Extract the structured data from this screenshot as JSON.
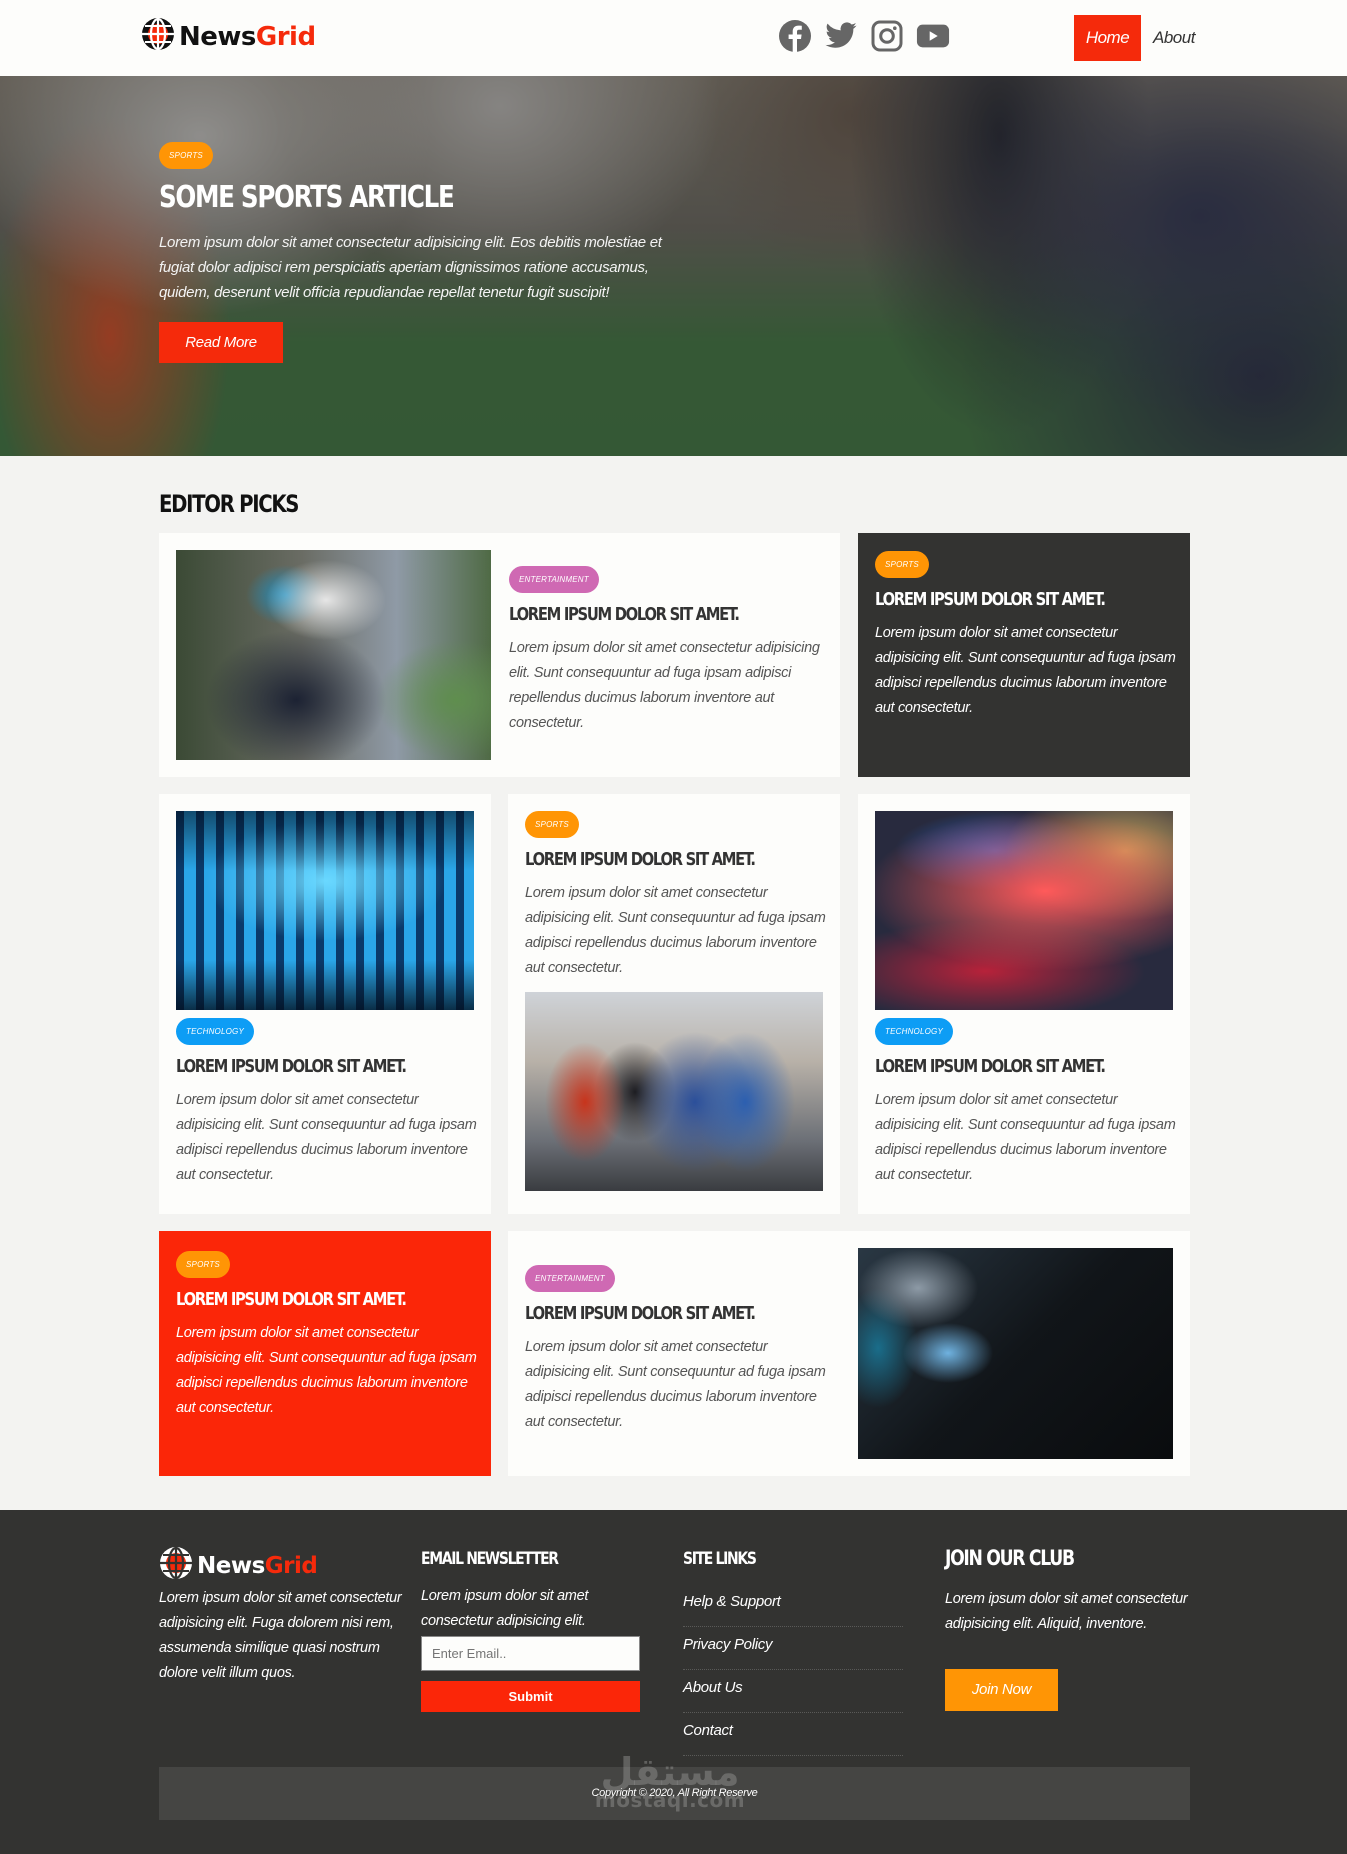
{
  "header": {
    "logo": {
      "part1": "News",
      "part2": "Grid",
      "icon": "globe-icon"
    },
    "social": [
      {
        "name": "facebook",
        "icon": "facebook-icon"
      },
      {
        "name": "twitter",
        "icon": "twitter-icon"
      },
      {
        "name": "instagram",
        "icon": "instagram-icon"
      },
      {
        "name": "youtube",
        "icon": "youtube-icon"
      }
    ],
    "nav": [
      {
        "label": "Home",
        "active": true
      },
      {
        "label": "About",
        "active": false
      }
    ]
  },
  "hero": {
    "badge": "Sports",
    "title": "Some Sports Article",
    "text": "Lorem ipsum dolor sit amet consectetur adipisicing elit. Eos debitis molestiae et fugiat dolor adipisci rem perspiciatis aperiam dignissimos ratione accusamus, quidem, deserunt velit officia repudiandae repellat tenetur fugit suscipit!",
    "button": "Read More"
  },
  "editor_picks": {
    "title": "Editor Picks",
    "cards": [
      {
        "badge": "Entertainment",
        "title": "Lorem ipsum dolor sit amet.",
        "text": "Lorem ipsum dolor sit amet consectetur adipisicing elit. Sunt consequuntur ad fuga ipsam adipisci repellendus ducimus laborum inventore aut consectetur.",
        "image": "vr-headset-man"
      },
      {
        "badge": "Sports",
        "title": "Lorem ipsum dolor sit amet.",
        "text": "Lorem ipsum dolor sit amet consectetur adipisicing elit. Sunt consequuntur ad fuga ipsam adipisci repellendus ducimus laborum inventore aut consectetur."
      },
      {
        "badge": "Technology",
        "title": "Lorem ipsum dolor sit amet.",
        "text": "Lorem ipsum dolor sit amet consectetur adipisicing elit. Sunt consequuntur ad fuga ipsam adipisci repellendus ducimus laborum inventore aut consectetur.",
        "image": "server-rack"
      },
      {
        "badge": "Sports",
        "title": "Lorem ipsum dolor sit amet.",
        "text": "Lorem ipsum dolor sit amet consectetur adipisicing elit. Sunt consequuntur ad fuga ipsam adipisci repellendus ducimus laborum inventore aut consectetur.",
        "image": "cyclists"
      },
      {
        "badge": "Technology",
        "title": "Lorem ipsum dolor sit amet.",
        "text": "Lorem ipsum dolor sit amet consectetur adipisicing elit. Sunt consequuntur ad fuga ipsam adipisci repellendus ducimus laborum inventore aut consectetur.",
        "image": "laptop-keyboard"
      },
      {
        "badge": "Sports",
        "title": "Lorem ipsum dolor sit amet.",
        "text": "Lorem ipsum dolor sit amet consectetur adipisicing elit. Sunt consequuntur ad fuga ipsam adipisci repellendus ducimus laborum inventore aut consectetur."
      },
      {
        "badge": "Entertainment",
        "title": "Lorem ipsum dolor sit amet.",
        "text": "Lorem ipsum dolor sit amet consectetur adipisicing elit. Sunt consequuntur ad fuga ipsam adipisci repellendus ducimus laborum inventore aut consectetur.",
        "image": "video-camera"
      }
    ]
  },
  "footer": {
    "logo": {
      "part1": "News",
      "part2": "Grid"
    },
    "about_text": "Lorem ipsum dolor sit amet consectetur adipisicing elit. Fuga dolorem nisi rem, assumenda similique quasi nostrum dolore velit illum quos.",
    "newsletter": {
      "title": "Email Newsletter",
      "text": "Lorem ipsum dolor sit amet consectetur adipisicing elit.",
      "placeholder": "Enter Email..",
      "button": "Submit"
    },
    "site_links": {
      "title": "Site Links",
      "items": [
        "Help & Support",
        "Privacy Policy",
        "About Us",
        "Contact"
      ]
    },
    "join": {
      "title": "Join Our Club",
      "text": "Lorem ipsum dolor sit amet consectetur adipisicing elit. Aliquid, inventore.",
      "button": "Join Now"
    },
    "copyright": "Copyright © 2020, All Right Reserve"
  },
  "watermark": {
    "arabic": "مستقل",
    "latin": "mostaql.com"
  },
  "colors": {
    "brand_red": "#f52a0b",
    "sports": "#ff9505",
    "entertainment": "#cf69b3",
    "technology": "#0d9df5",
    "dark": "#333331",
    "page_bg": "#f3f3f1"
  }
}
